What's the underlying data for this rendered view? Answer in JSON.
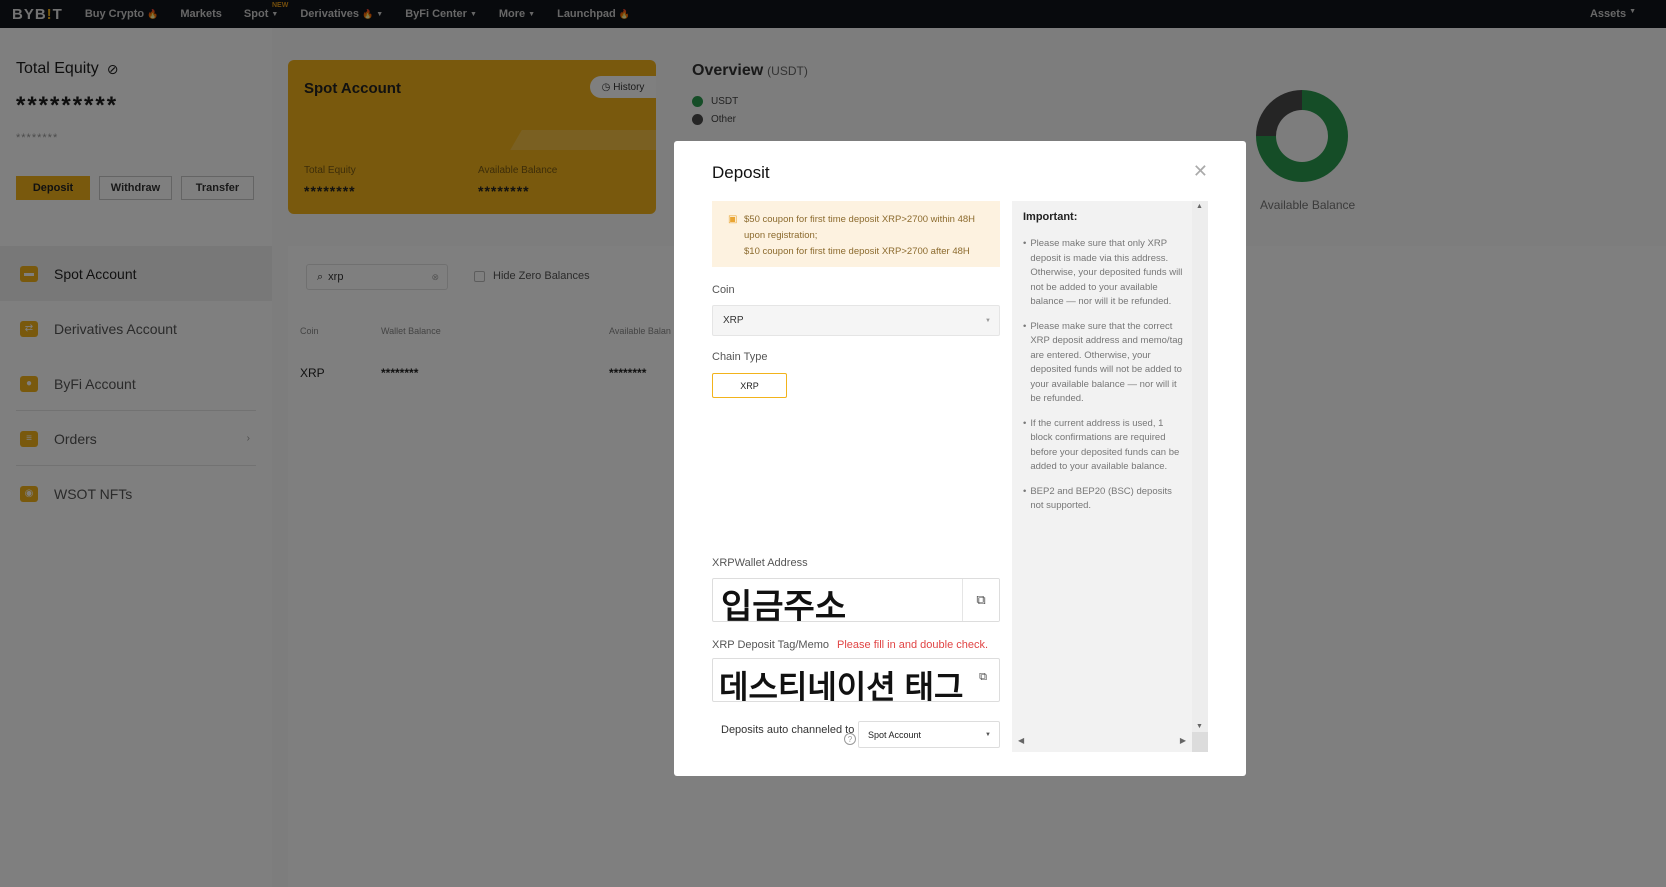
{
  "nav": {
    "logo_a": "BYB",
    "logo_b": "!",
    "logo_c": "T",
    "items": [
      {
        "label": "Buy Crypto"
      },
      {
        "label": "Markets"
      },
      {
        "label": "Spot"
      },
      {
        "label": "Derivatives"
      },
      {
        "label": "ByFi Center"
      },
      {
        "label": "More"
      },
      {
        "label": "Launchpad"
      }
    ],
    "new_tag": "NEW",
    "assets": "Assets"
  },
  "sidebar": {
    "total_equity_label": "Total Equity",
    "total_equity_value": "*********",
    "total_equity_sub": "********",
    "deposit": "Deposit",
    "withdraw": "Withdraw",
    "transfer": "Transfer",
    "menu": [
      {
        "label": "Spot Account"
      },
      {
        "label": "Derivatives Account"
      },
      {
        "label": "ByFi Account"
      },
      {
        "label": "Orders"
      },
      {
        "label": "WSOT NFTs"
      }
    ]
  },
  "spot_card": {
    "title": "Spot Account",
    "history": "History",
    "total_equity_label": "Total Equity",
    "total_equity_value": "********",
    "total_equity_sub": "********",
    "available_label": "Available Balance",
    "available_value": "********",
    "available_sub": "********"
  },
  "overview": {
    "title": "Overview",
    "unit": "(USDT)",
    "legend": [
      {
        "label": "USDT",
        "color": "#2a9b4f"
      },
      {
        "label": "Other",
        "color": "#4a4a4a"
      }
    ],
    "donut_label": "Available Balance"
  },
  "table": {
    "search_value": "xrp",
    "hide_zero": "Hide Zero Balances",
    "headers": [
      "Coin",
      "Wallet Balance",
      "Available Balan"
    ],
    "row": {
      "coin": "XRP",
      "wallet": "********",
      "available": "********"
    }
  },
  "modal": {
    "title": "Deposit",
    "promo_line1": "$50 coupon for first time deposit XRP>2700 within 48H",
    "promo_line2": "upon registration;",
    "promo_line3": "$10 coupon for first time deposit XRP>2700 after 48H",
    "coin_label": "Coin",
    "coin_value": "XRP",
    "chain_label": "Chain Type",
    "chain_value": "XRP",
    "address_label": "XRPWallet Address",
    "address_value": "입금주소",
    "tag_label": "XRP Deposit Tag/Memo",
    "tag_warning": "Please fill in and double check.",
    "tag_value": "데스티네이션 태그",
    "auto_label": "Deposits auto channeled to",
    "auto_value": "Spot Account",
    "important_title": "Important:",
    "important_items": [
      "Please make sure that only XRP deposit is made via this address. Otherwise, your deposited funds will not be added to your available balance — nor will it be refunded.",
      "Please make sure that the correct XRP deposit address and memo/tag are entered. Otherwise, your deposited funds will not be added to your available balance — nor will it be refunded.",
      "If the current address is used, 1 block confirmations are required before your deposited funds can be added to your available balance.",
      "BEP2 and BEP20 (BSC) deposits not supported."
    ]
  },
  "colors": {
    "accent": "#f2b31b",
    "danger": "#e04444"
  }
}
